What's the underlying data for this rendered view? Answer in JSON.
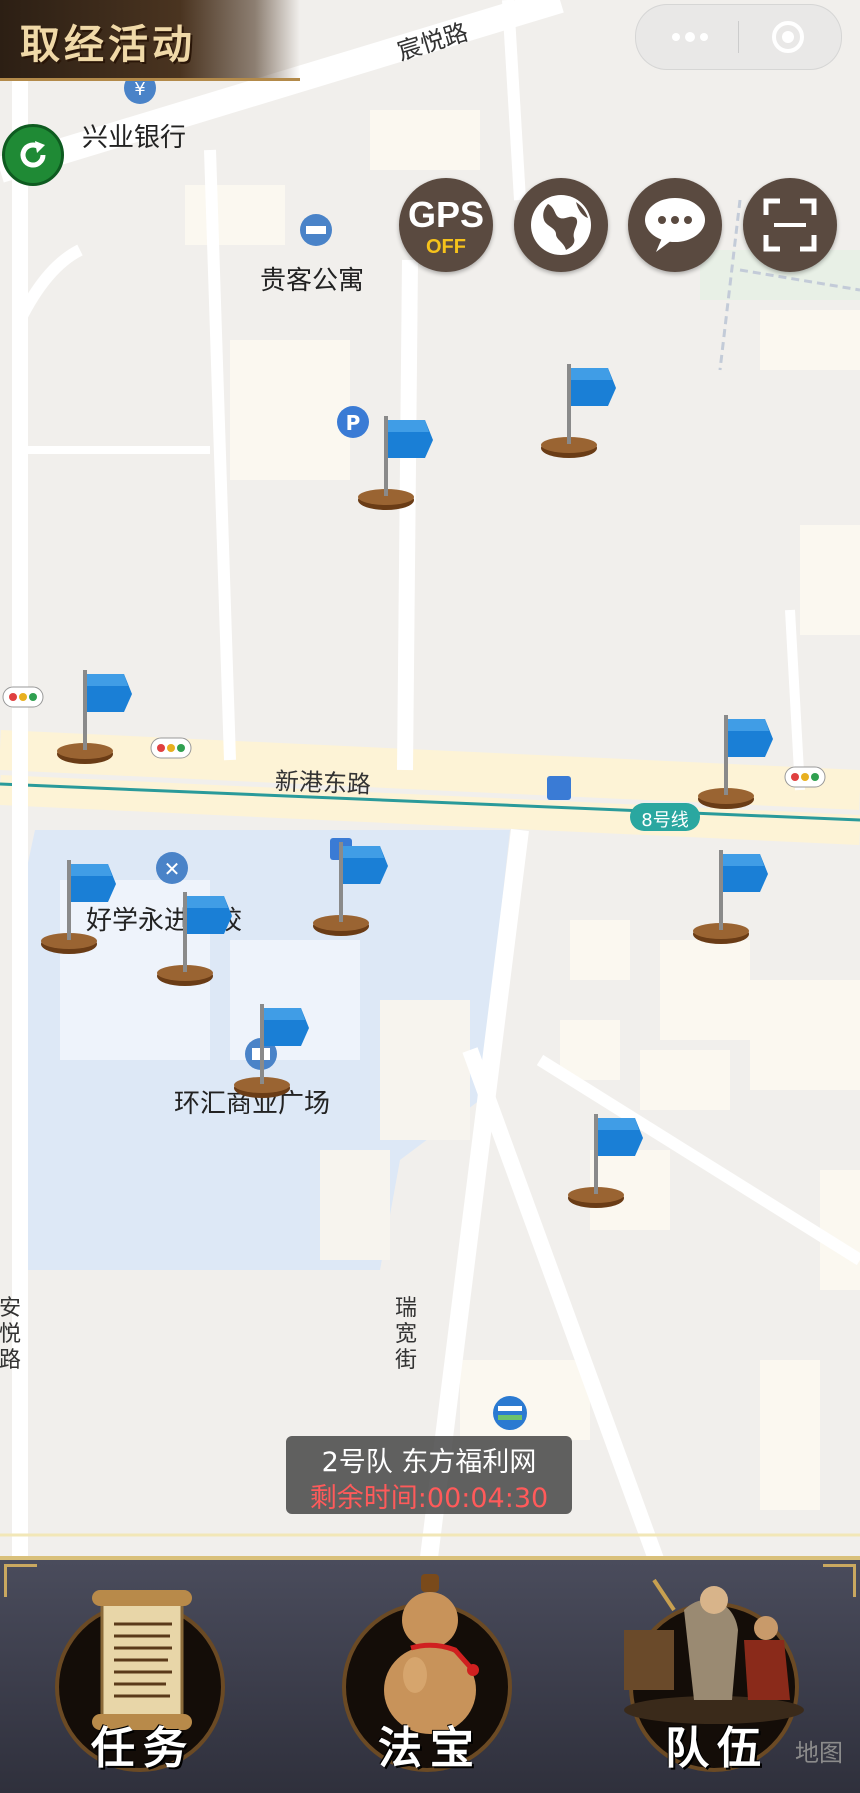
{
  "header": {
    "title": "取经活动"
  },
  "capsule": {
    "menu_icon": "more-dots-icon",
    "close_icon": "target-circle-icon"
  },
  "map_buttons": {
    "gps_label": "GPS",
    "gps_state": "OFF",
    "globe_icon": "globe-icon",
    "chat_icon": "chat-bubble-icon",
    "scan_icon": "scan-icon"
  },
  "map": {
    "pois": {
      "bank": "兴业银行",
      "apartment": "贵客公寓",
      "school": "好学永进学校",
      "plaza": "环汇商业广场"
    },
    "roads": {
      "chenyue": "宸悦路",
      "xingang": "新港东路",
      "ruikuan": "瑞宽街",
      "anyue": "安悦路"
    },
    "metro_badge": "8号线"
  },
  "team_info": {
    "team": "2号队 东方福利网",
    "remaining": "剩余时间:00:04:30"
  },
  "bottom_nav": {
    "tasks": "任务",
    "treasure": "法宝",
    "team": "队伍"
  },
  "watermark": "地图",
  "colors": {
    "flag_blue": "#1a7fd6",
    "accent_gold": "#d9c07a",
    "timer_red": "#ff5a5a",
    "refresh_green": "#1f8a35"
  }
}
